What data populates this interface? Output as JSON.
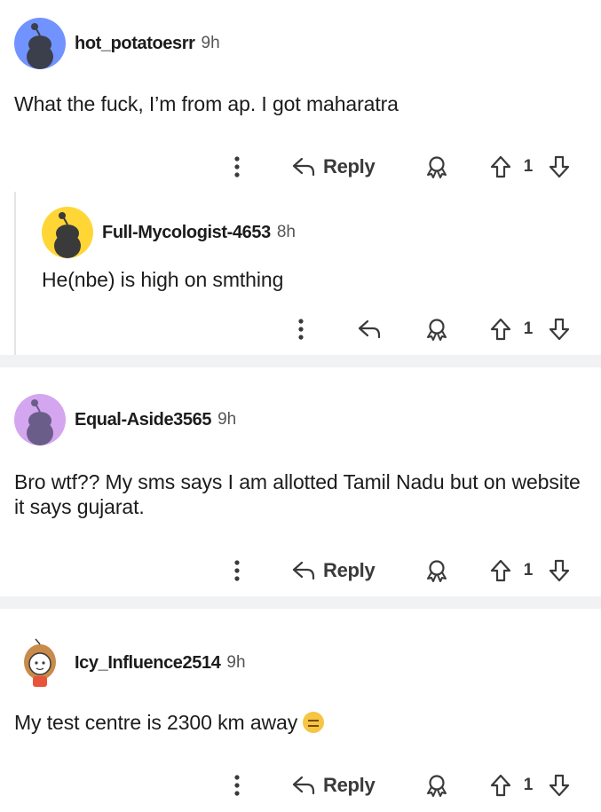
{
  "comments": [
    {
      "username": "hot_potatoesrr",
      "time": "9h",
      "text": "What the fuck, I’m from ap. I got maharatra",
      "reply_label": "Reply",
      "votes": "1",
      "avatar_color": "#7193ff"
    },
    {
      "username": "Full-Mycologist-4653",
      "time": "8h",
      "text": "He(nbe) is high on smthing",
      "votes": "1",
      "avatar_color": "#ffd635"
    },
    {
      "username": "Equal-Aside3565",
      "time": "9h",
      "text": "Bro wtf?? My sms says I am allotted Tamil Nadu but on website it says gujarat.",
      "reply_label": "Reply",
      "votes": "1",
      "avatar_color": "#d4a6f0"
    },
    {
      "username": "Icy_Influence2514",
      "time": "9h",
      "text": "My test centre is 2300 km away",
      "emoji": "expressionless-face-emoji",
      "reply_label": "Reply",
      "votes": "1",
      "avatar_color": "#ffffff"
    }
  ],
  "icons": {
    "more": "more-options-icon",
    "reply": "reply-arrow-icon",
    "award": "award-icon",
    "upvote": "upvote-arrow-icon",
    "downvote": "downvote-arrow-icon"
  }
}
